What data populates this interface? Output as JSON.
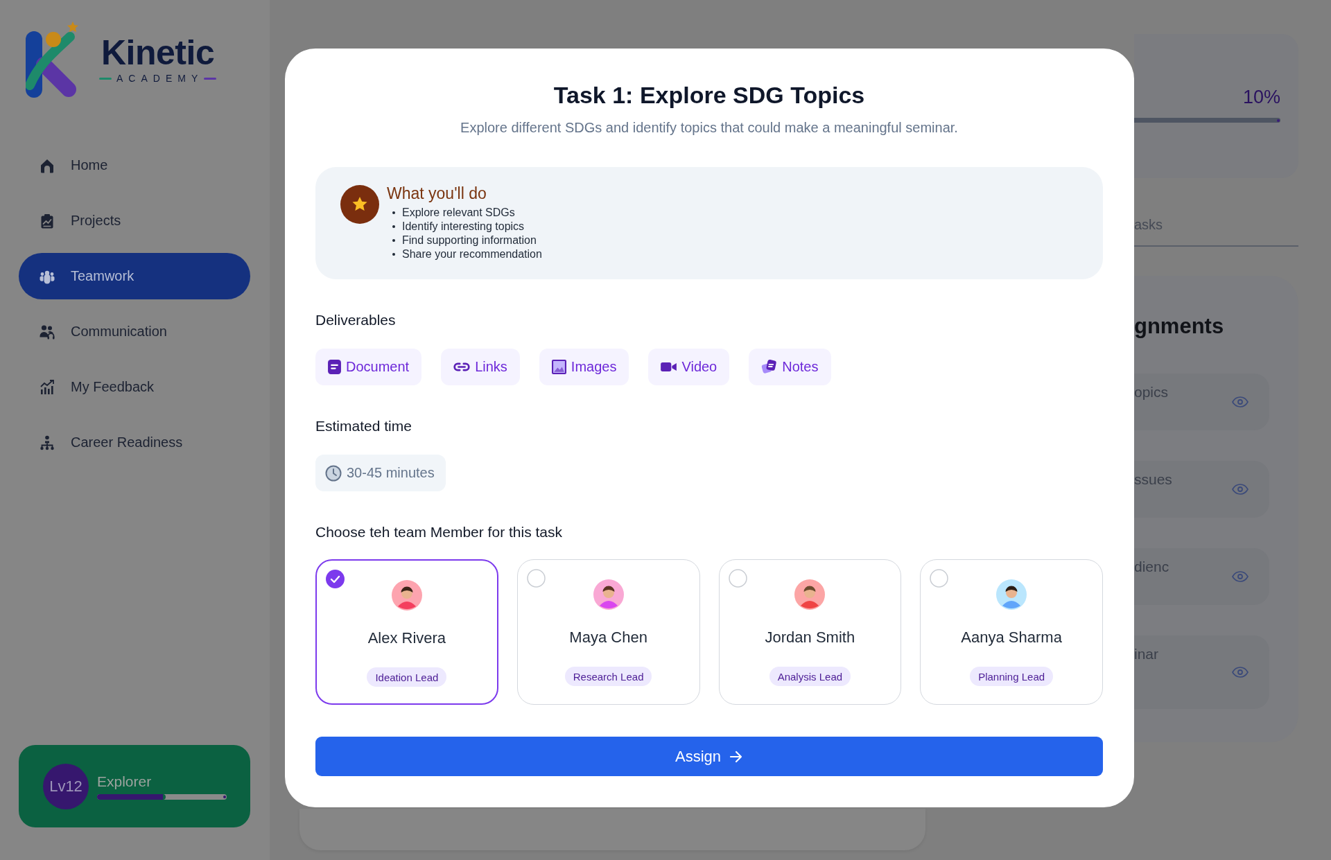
{
  "sidebar": {
    "logo": {
      "name": "Kinetic",
      "tagline": "ACADEMY"
    },
    "nav": [
      {
        "label": "Home",
        "selected": false
      },
      {
        "label": "Projects",
        "selected": false
      },
      {
        "label": "Teamwork",
        "selected": true
      },
      {
        "label": "Communication",
        "selected": false
      },
      {
        "label": "My Feedback",
        "selected": false
      },
      {
        "label": "Career Readiness",
        "selected": false
      }
    ],
    "level_card": {
      "badge": "Lv12",
      "title": "Explorer",
      "level": 0.53
    }
  },
  "background": {
    "progress_reading": "10%",
    "tab": "asks",
    "heading": "gnments",
    "items": [
      "opics",
      "ssues",
      "dienc",
      "inar"
    ]
  },
  "modal": {
    "title": "Task 1: Explore SDG Topics",
    "subtitle": "Explore different SDGs and identify topics that could make a meaningful seminar.",
    "what_youll_do": {
      "heading": "What you'll do",
      "items": [
        "Explore relevant SDGs",
        "Identify interesting topics",
        "Find supporting information",
        "Share your recommendation"
      ]
    },
    "deliverables": {
      "label": "Deliverables",
      "items": [
        "Document",
        "Links",
        "Images",
        "Video",
        "Notes"
      ]
    },
    "estimated_time": {
      "label": "Estimated time",
      "value": "30-45 minutes"
    },
    "members": {
      "label": "Choose teh team Member for this task",
      "items": [
        {
          "name": "Alex Rivera",
          "role": "Ideation Lead",
          "selected": true
        },
        {
          "name": "Maya Chen",
          "role": "Research Lead",
          "selected": false
        },
        {
          "name": "Jordan Smith",
          "role": "Analysis Lead",
          "selected": false
        },
        {
          "name": "Aanya Sharma",
          "role": "Planning Lead",
          "selected": false
        }
      ]
    },
    "assign_button": "Assign"
  }
}
